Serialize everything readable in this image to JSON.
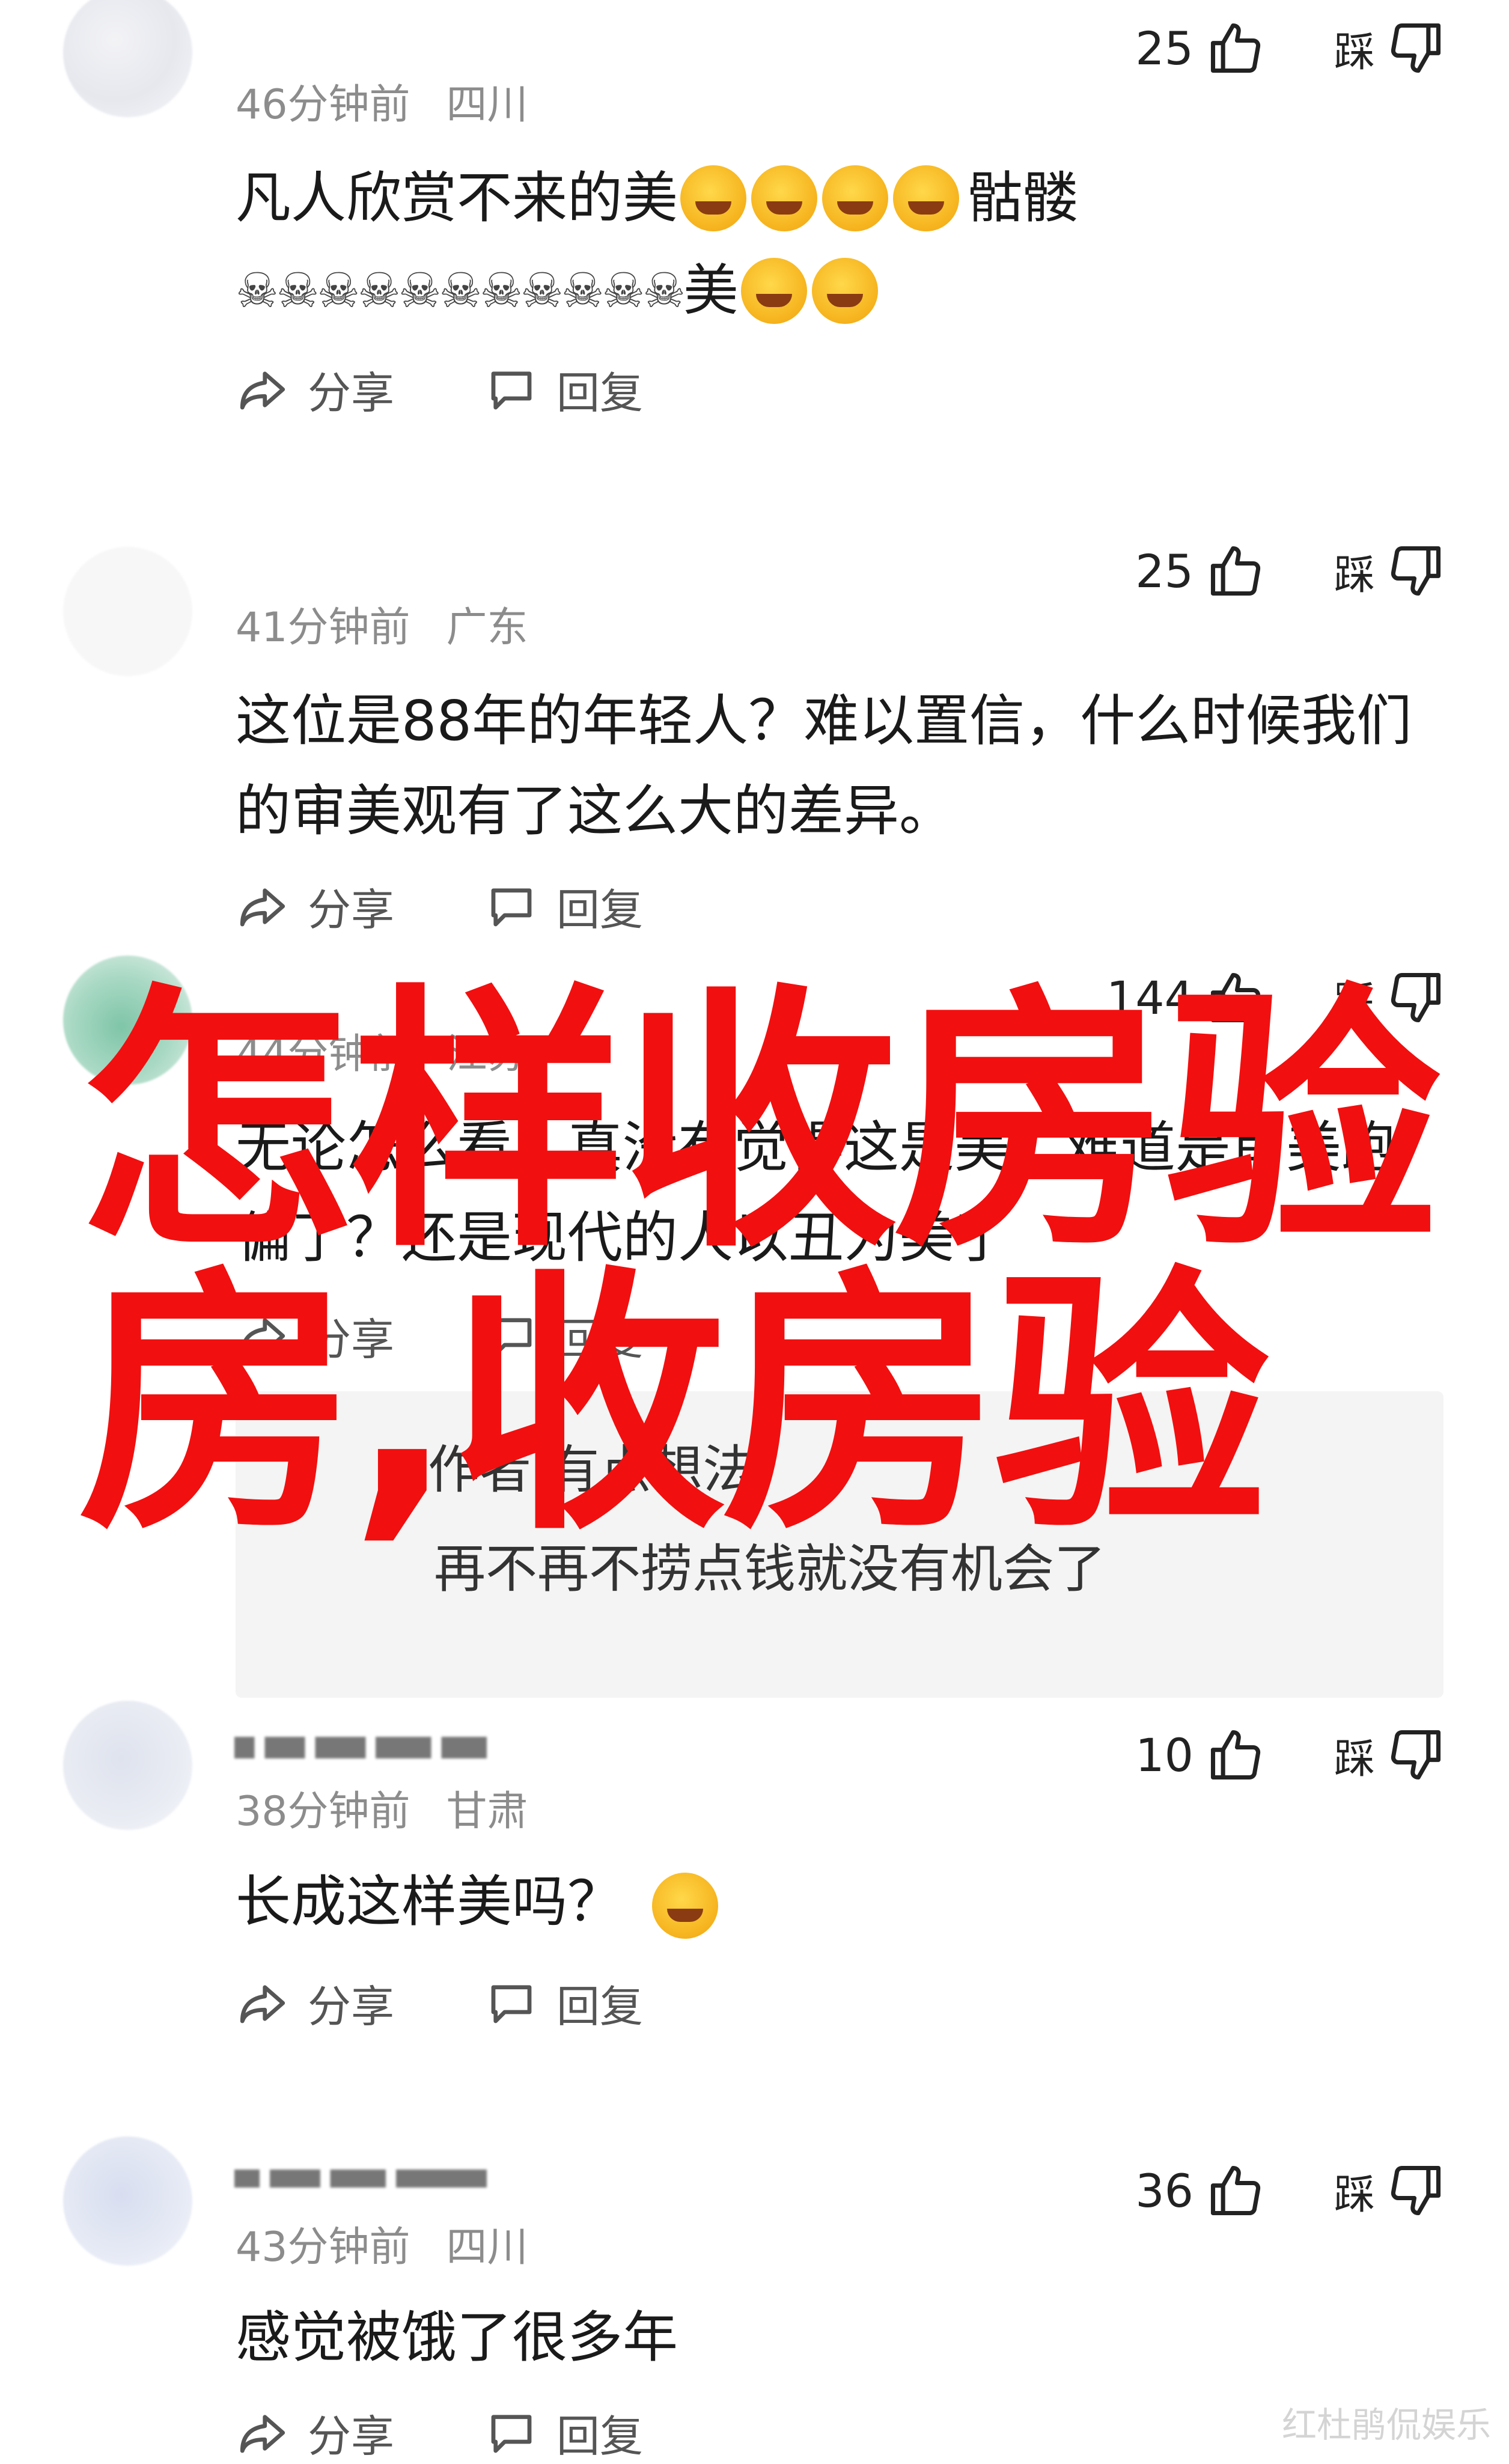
{
  "comments": [
    {
      "time": "46分钟前",
      "location": "四川",
      "likes": "25",
      "dislike_label": "踩",
      "line1_text": "凡人欣赏不来的美",
      "line1_tail": "骷髅",
      "line2_skulls": "☠☠☠☠☠☠☠☠☠☠☠",
      "line2_text": "美",
      "share_label": "分享",
      "reply_label": "回复"
    },
    {
      "time": "41分钟前",
      "location": "广东",
      "likes": "25",
      "dislike_label": "踩",
      "text": "这位是88年的年轻人？难以置信，什么时候我们的审美观有了这么大的差异。",
      "share_label": "分享",
      "reply_label": "回复"
    },
    {
      "time": "44分钟前",
      "location": "江苏",
      "likes": "144",
      "dislike_label": "踩",
      "text": "无论怎么看，真没有觉得这是美，难道是审美跑偏了？还是现代的人以丑为美了",
      "share_label": "分享",
      "reply_label": "回复",
      "reply_line1": "作者 有点想法",
      "reply_line2": "再不再不捞点钱就没有机会了"
    },
    {
      "time": "38分钟前",
      "location": "甘肃",
      "likes": "10",
      "dislike_label": "踩",
      "text": "长成这样美吗？",
      "share_label": "分享",
      "reply_label": "回复"
    },
    {
      "time": "43分钟前",
      "location": "四川",
      "likes": "36",
      "dislike_label": "踩",
      "text": "感觉被饿了很多年",
      "share_label": "分享",
      "reply_label": "回复"
    }
  ],
  "overlay": {
    "line1": "怎样收房验",
    "line2": "房,收房验",
    "color": "#f20f0f"
  },
  "watermark": "红杜鹃侃娱乐"
}
